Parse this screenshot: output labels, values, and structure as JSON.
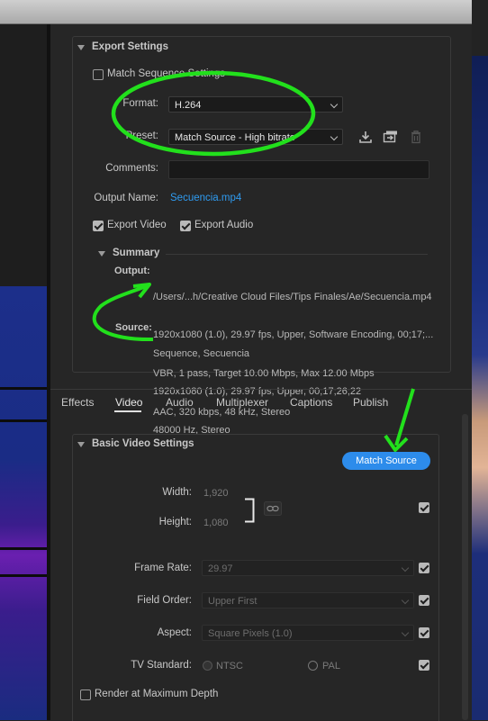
{
  "export_settings": {
    "heading": "Export Settings",
    "match_sequence_label": "Match Sequence Settings",
    "format_label": "Format:",
    "format_value": "H.264",
    "preset_label": "Preset:",
    "preset_value": "Match Source - High bitrate",
    "comments_label": "Comments:",
    "output_name_label": "Output Name:",
    "output_name_value": "Secuencia.mp4",
    "export_video_label": "Export Video",
    "export_audio_label": "Export Audio"
  },
  "summary": {
    "heading": "Summary",
    "output_label": "Output:",
    "output_lines": [
      "/Users/...h/Creative Cloud Files/Tips Finales/Ae/Secuencia.mp4",
      "1920x1080 (1.0), 29.97 fps, Upper, Software Encoding, 00;17;...",
      "VBR, 1 pass, Target 10.00 Mbps, Max 12.00 Mbps",
      "AAC, 320 kbps, 48 kHz, Stereo"
    ],
    "source_label": "Source:",
    "source_lines": [
      "Sequence, Secuencia",
      "1920x1080 (1.0), 29.97 fps, Upper, 00;17;26;22",
      "48000 Hz, Stereo"
    ]
  },
  "tabs": [
    "Effects",
    "Video",
    "Audio",
    "Multiplexer",
    "Captions",
    "Publish"
  ],
  "video": {
    "heading": "Basic Video Settings",
    "match_source_button": "Match Source",
    "width_label": "Width:",
    "width_value": "1,920",
    "height_label": "Height:",
    "height_value": "1,080",
    "frame_rate_label": "Frame Rate:",
    "frame_rate_value": "29.97",
    "field_order_label": "Field Order:",
    "field_order_value": "Upper First",
    "aspect_label": "Aspect:",
    "aspect_value": "Square Pixels (1.0)",
    "tv_standard_label": "TV Standard:",
    "ntsc_label": "NTSC",
    "pal_label": "PAL",
    "render_max_depth_label": "Render at Maximum Depth"
  },
  "colors": {
    "panel_bg": "#262626",
    "link_blue": "#2f9bf0",
    "button_blue": "#2d8ceb",
    "annotation_green": "#22e01c"
  },
  "icons": [
    "save-preset-icon",
    "import-preset-icon",
    "delete-preset-icon",
    "chain-link-icon"
  ]
}
